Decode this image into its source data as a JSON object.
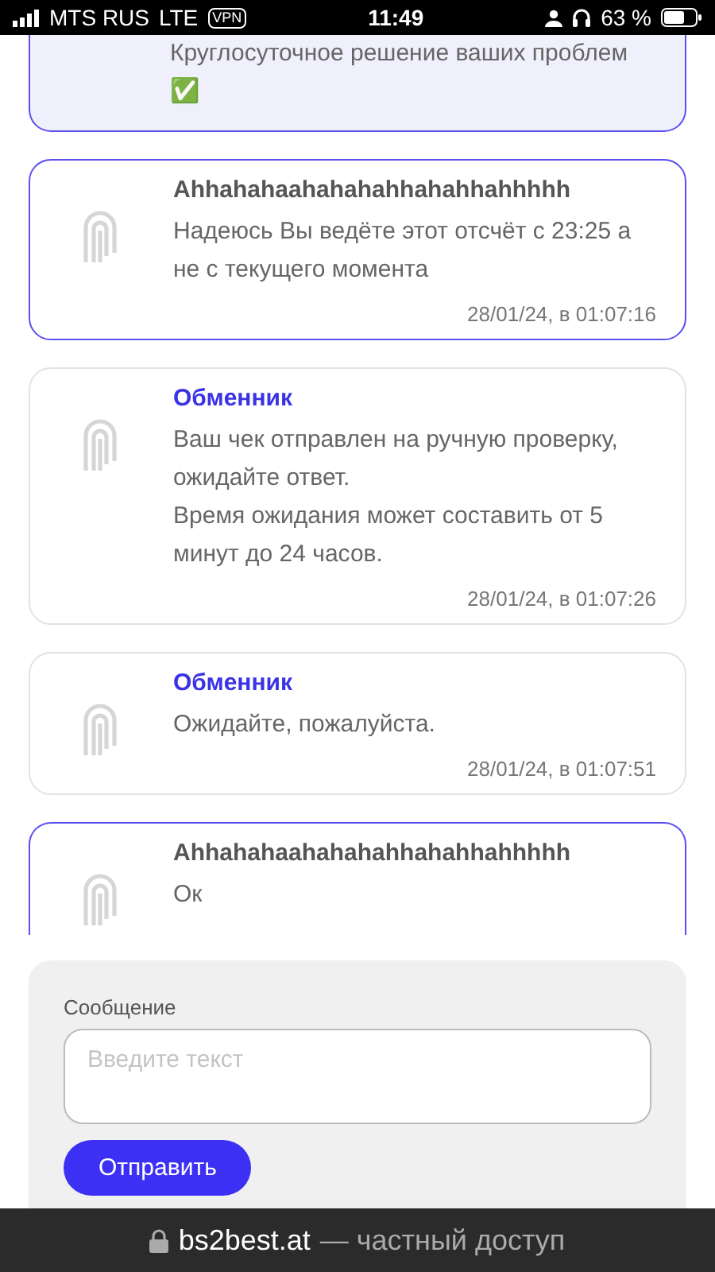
{
  "status_bar": {
    "carrier": "MTS RUS",
    "network": "LTE",
    "vpn": "VPN",
    "time": "11:49",
    "battery": "63 %"
  },
  "messages": [
    {
      "kind": "info",
      "text": "Круглосуточное решение ваших проблем ✅"
    },
    {
      "kind": "user",
      "author": "Ahhahahaahahahahhahahhahhhhh",
      "text": "Надеюсь Вы ведёте этот отсчёт с 23:25 а не с текущего момента",
      "time": "28/01/24, в 01:07:16"
    },
    {
      "kind": "operator",
      "author": "Обменник",
      "text": "Ваш чек отправлен на ручную проверку, ожидайте ответ.\nВремя ожидания может составить от 5 минут до 24 часов.",
      "time": "28/01/24, в 01:07:26"
    },
    {
      "kind": "operator",
      "author": "Обменник",
      "text": "Ожидайте, пожалуйста.",
      "time": "28/01/24, в 01:07:51"
    },
    {
      "kind": "user",
      "author": "Ahhahahaahahahahhahahhahhhhh",
      "text": "Ок"
    }
  ],
  "composer": {
    "label": "Сообщение",
    "placeholder": "Введите текст",
    "send": "Отправить"
  },
  "address_bar": {
    "domain": "bs2best.at",
    "note": "— частный доступ"
  }
}
